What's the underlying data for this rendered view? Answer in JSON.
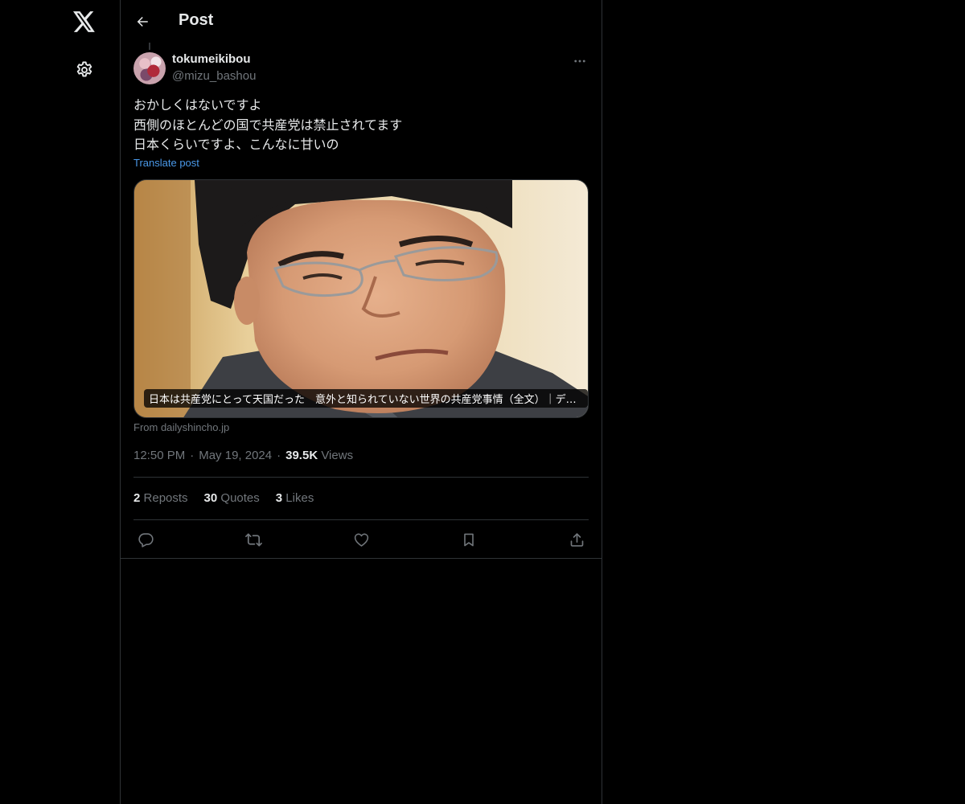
{
  "colors": {
    "background": "#000000",
    "text_primary": "#e7e9ea",
    "text_secondary": "#71767b",
    "link": "#4a99e9",
    "border": "#2f3336"
  },
  "icons": {
    "logo": "x-logo-icon",
    "settings": "gear-icon",
    "back": "arrow-left-icon",
    "more": "more-horizontal-icon",
    "reply": "reply-icon",
    "repost": "repost-icon",
    "like": "heart-icon",
    "bookmark": "bookmark-icon",
    "share": "share-icon"
  },
  "header": {
    "title": "Post"
  },
  "post": {
    "author": {
      "display_name": "tokumeikibou",
      "handle": "@mizu_bashou"
    },
    "text_lines": [
      "おかしくはないですよ",
      "西側のほとんどの国で共産党は禁止されてます",
      "日本くらいですよ、こんなに甘いの"
    ],
    "translate_label": "Translate post",
    "card": {
      "title": "日本は共産党にとって天国だった　意外と知られていない世界の共産党事情（全文）｜デイリー新潮",
      "source": "From dailyshincho.jp"
    },
    "time": "12:50 PM",
    "date": "May 19, 2024",
    "views_count": "39.5K",
    "views_label": "Views",
    "separator": "·",
    "stats": {
      "reposts_count": "2",
      "reposts_label": "Reposts",
      "quotes_count": "30",
      "quotes_label": "Quotes",
      "likes_count": "3",
      "likes_label": "Likes"
    }
  }
}
